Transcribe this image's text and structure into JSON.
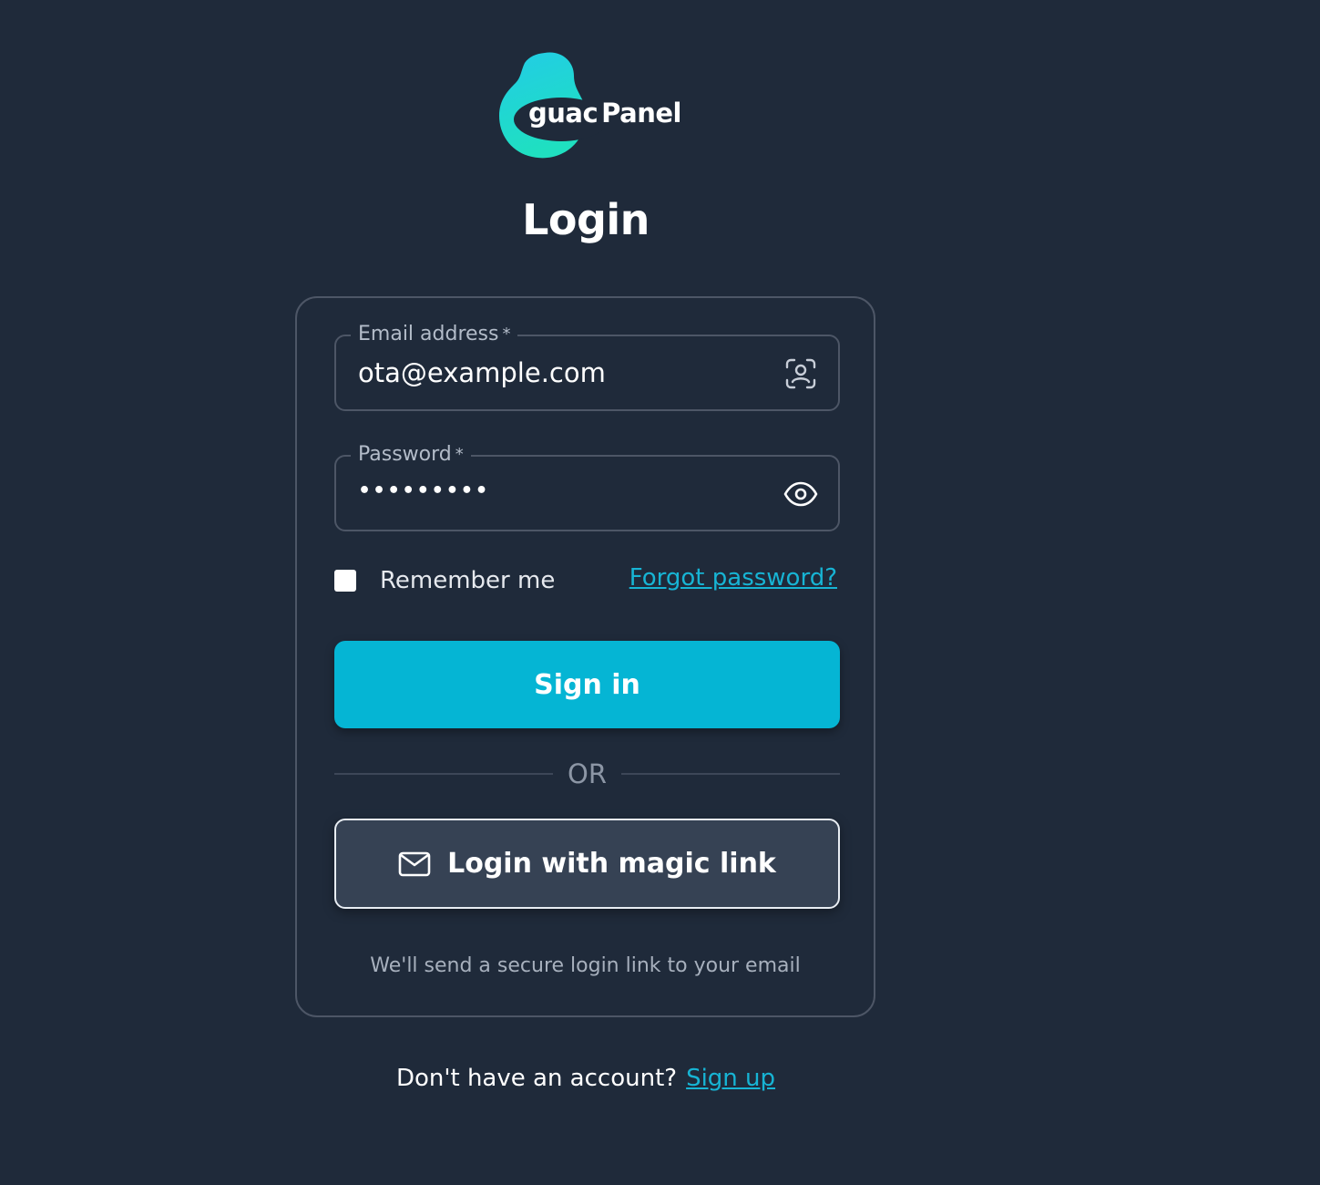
{
  "brand": {
    "logo_part1": "guac",
    "logo_part2": "Panel",
    "accent": "#05b5d4",
    "logo_gradient": [
      "#1fd9c4",
      "#22c4e0"
    ]
  },
  "title": "Login",
  "email": {
    "label": "Email address",
    "required_mark": "*",
    "value": "ota@example.com",
    "icon": "face-scan-icon"
  },
  "password": {
    "label": "Password",
    "required_mark": "*",
    "value_masked": "•••••••••",
    "icon": "eye-icon"
  },
  "remember": {
    "label": "Remember me",
    "checked": false
  },
  "forgot_label": "Forgot password?",
  "signin_label": "Sign in",
  "divider_label": "OR",
  "magic_link": {
    "label": "Login with magic link",
    "icon": "mail-icon",
    "hint": "We'll send a secure login link to your email"
  },
  "footer": {
    "prompt": "Don't have an account?",
    "signup_label": "Sign up"
  }
}
